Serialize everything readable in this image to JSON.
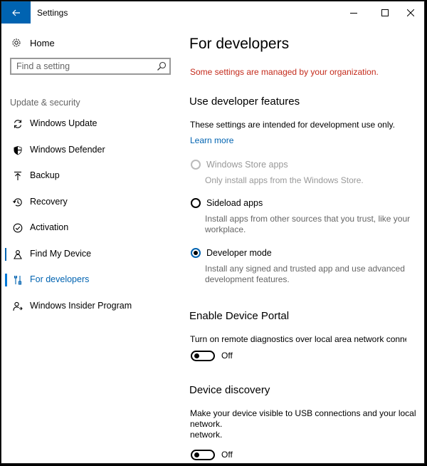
{
  "window": {
    "title": "Settings"
  },
  "sidebar": {
    "home_label": "Home",
    "search_placeholder": "Find a setting",
    "section_header": "Update & security",
    "items": [
      {
        "label": "Windows Update",
        "icon": "refresh-icon"
      },
      {
        "label": "Windows Defender",
        "icon": "shield-icon"
      },
      {
        "label": "Backup",
        "icon": "backup-arrow-icon"
      },
      {
        "label": "Recovery",
        "icon": "history-icon"
      },
      {
        "label": "Activation",
        "icon": "check-circle-icon"
      },
      {
        "label": "Find My Device",
        "icon": "person-location-icon"
      },
      {
        "label": "For developers",
        "icon": "developer-tools-icon",
        "selected": true
      },
      {
        "label": "Windows Insider Program",
        "icon": "insider-icon"
      }
    ]
  },
  "main": {
    "title": "For developers",
    "managed_notice": "Some settings are managed by your organization.",
    "developer_features": {
      "heading": "Use developer features",
      "description": "These settings are intended for development use only.",
      "learn_more": "Learn more",
      "options": [
        {
          "label": "Windows Store apps",
          "description": "Only install apps from the Windows Store.",
          "state": "disabled"
        },
        {
          "label": "Sideload apps",
          "description": "Install apps from other sources that you trust, like your workplace.",
          "state": "unchecked"
        },
        {
          "label": "Developer mode",
          "description": "Install any signed and trusted app and use advanced development features.",
          "state": "checked"
        }
      ]
    },
    "device_portal": {
      "heading": "Enable Device Portal",
      "description": "Turn on remote diagnostics over local area network connecti",
      "toggle_label": "Off"
    },
    "device_discovery": {
      "heading": "Device discovery",
      "description_line1": "Make your device visible to USB connections and your local",
      "description_line2": "network.",
      "description_line3": "network.",
      "toggle_label": "Off"
    }
  },
  "colors": {
    "accent": "#0063b1",
    "warning": "#c42b1c"
  }
}
